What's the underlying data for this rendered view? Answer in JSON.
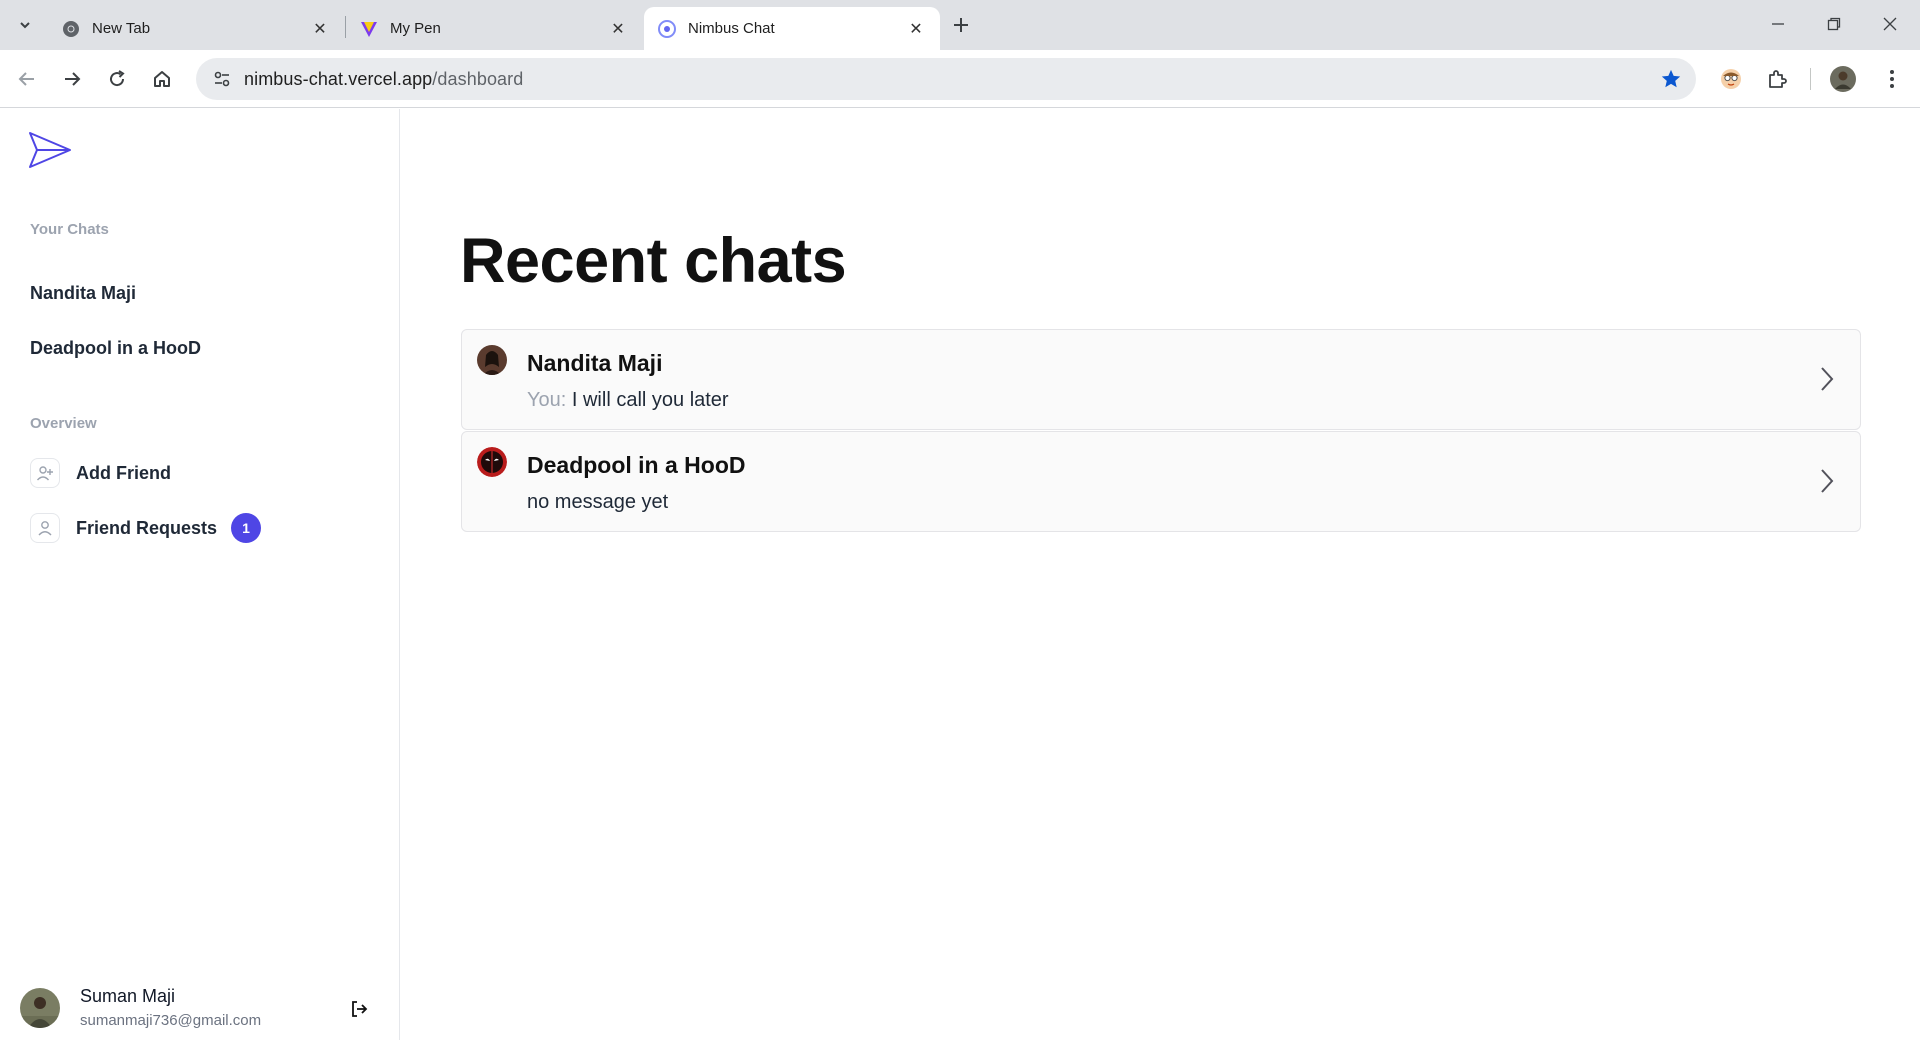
{
  "browser": {
    "tabs": [
      {
        "title": "New Tab",
        "icon": "chrome-icon"
      },
      {
        "title": "My Pen",
        "icon": "codepen-icon"
      },
      {
        "title": "Nimbus Chat",
        "icon": "nimbus-icon",
        "active": true
      }
    ],
    "url_host": "nimbus-chat.vercel.app",
    "url_path": "/dashboard",
    "accent_color": "#0b57d0"
  },
  "sidebar": {
    "your_chats_label": "Your Chats",
    "chats": [
      {
        "name": "Nandita Maji"
      },
      {
        "name": "Deadpool in a HooD"
      }
    ],
    "overview_label": "Overview",
    "overview_items": [
      {
        "label": "Add Friend",
        "icon": "user-plus-icon"
      },
      {
        "label": "Friend Requests",
        "icon": "user-icon",
        "badge": "1"
      }
    ],
    "profile": {
      "name": "Suman Maji",
      "email": "sumanmaji736@gmail.com"
    }
  },
  "main": {
    "title": "Recent chats",
    "chats": [
      {
        "name": "Nandita Maji",
        "prefix": "You: ",
        "message": "I will call you later"
      },
      {
        "name": "Deadpool in a HooD",
        "prefix": "",
        "message": "no message yet"
      }
    ]
  },
  "colors": {
    "brand": "#4f46e5",
    "badge": "#4f46e5"
  }
}
